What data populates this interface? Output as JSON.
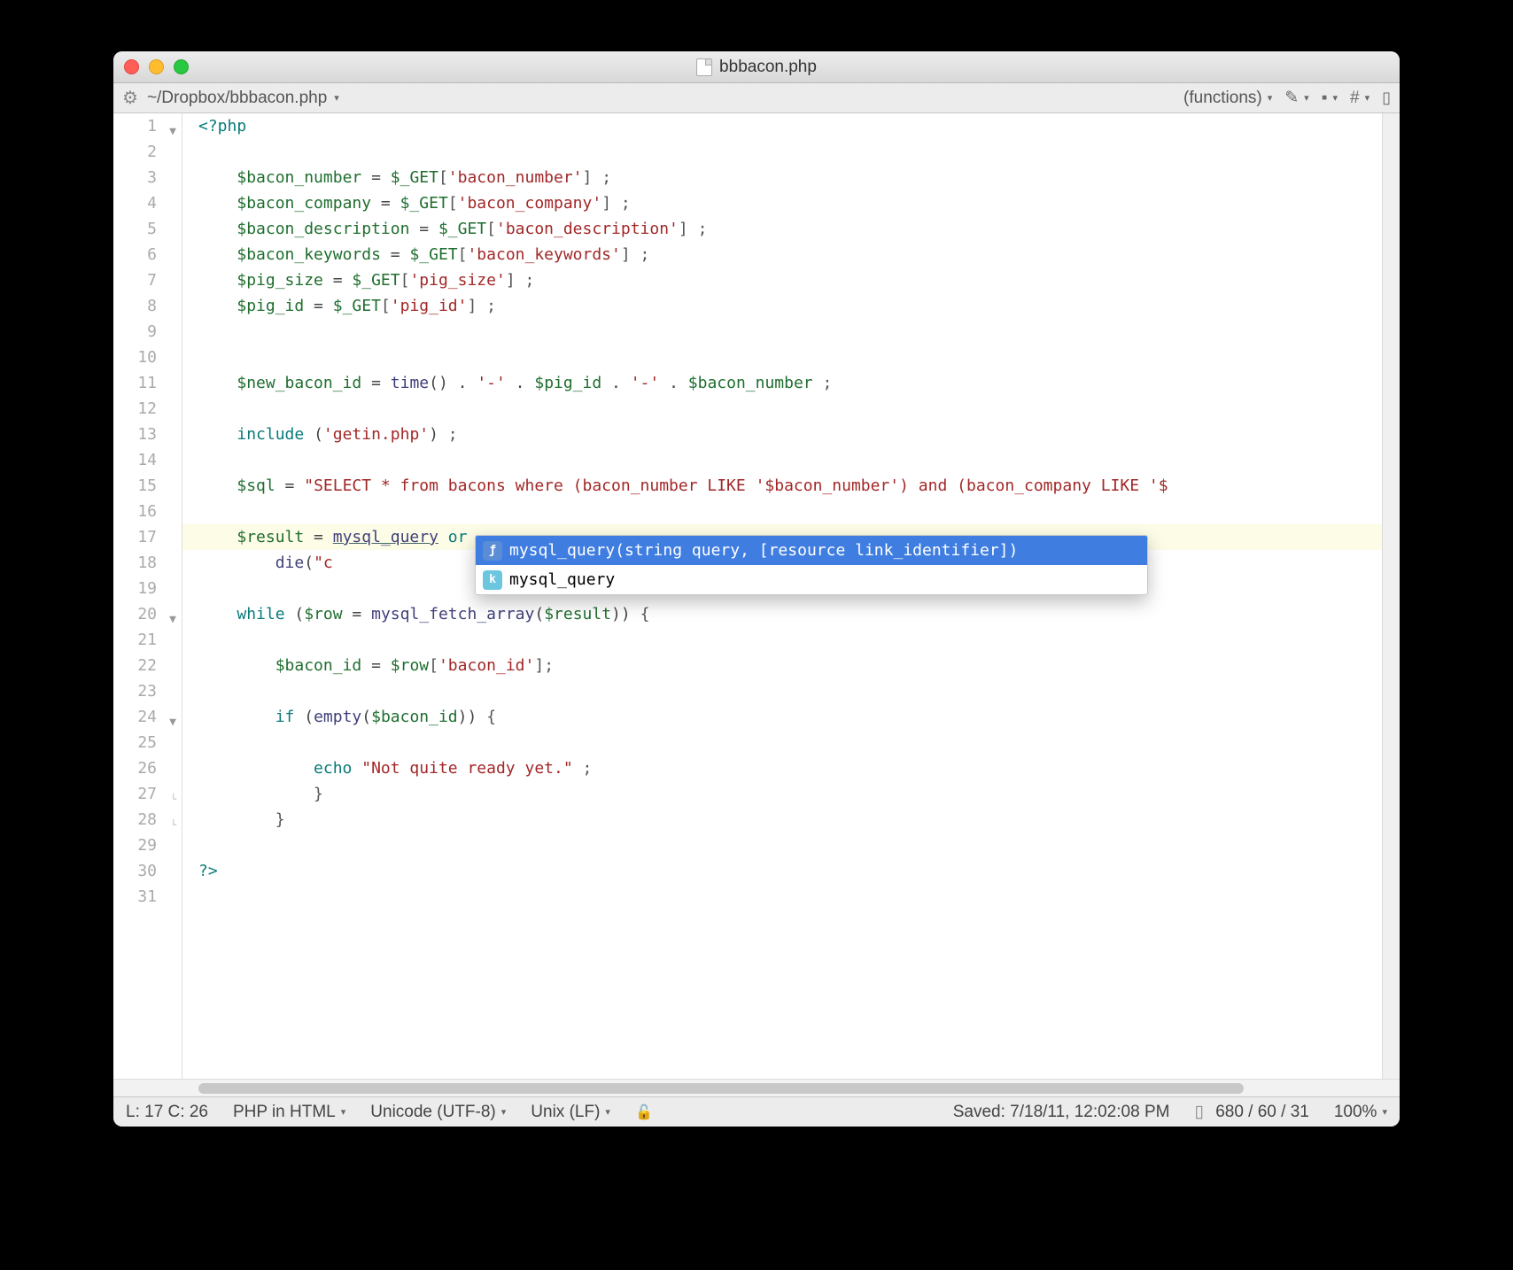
{
  "window": {
    "title": "bbbacon.php"
  },
  "toolbar": {
    "path": "~/Dropbox/bbbacon.php",
    "functions_label": "(functions)"
  },
  "gutter": {
    "lines": [
      "1",
      "2",
      "3",
      "4",
      "5",
      "6",
      "7",
      "8",
      "9",
      "10",
      "11",
      "12",
      "13",
      "14",
      "15",
      "16",
      "17",
      "18",
      "19",
      "20",
      "21",
      "22",
      "23",
      "24",
      "25",
      "26",
      "27",
      "28",
      "29",
      "30",
      "31"
    ],
    "fold_open": [
      1,
      20,
      24
    ],
    "fold_close": [
      27,
      28
    ]
  },
  "code": {
    "lines": {
      "l1_open": "<?php",
      "l3": {
        "var": "$bacon_number",
        "eq": " = ",
        "glob": "$_GET",
        "br1": "[",
        "str": "'bacon_number'",
        "br2": "]",
        "end": " ;"
      },
      "l4": {
        "var": "$bacon_company",
        "eq": " = ",
        "glob": "$_GET",
        "br1": "[",
        "str": "'bacon_company'",
        "br2": "]",
        "end": " ;"
      },
      "l5": {
        "var": "$bacon_description",
        "eq": " = ",
        "glob": "$_GET",
        "br1": "[",
        "str": "'bacon_description'",
        "br2": "]",
        "end": " ;"
      },
      "l6": {
        "var": "$bacon_keywords",
        "eq": " = ",
        "glob": "$_GET",
        "br1": "[",
        "str": "'bacon_keywords'",
        "br2": "]",
        "end": " ;"
      },
      "l7": {
        "var": "$pig_size",
        "eq": " = ",
        "glob": "$_GET",
        "br1": "[",
        "str": "'pig_size'",
        "br2": "]",
        "end": " ;"
      },
      "l8": {
        "var": "$pig_id",
        "eq": " = ",
        "glob": "$_GET",
        "br1": "[",
        "str": "'pig_id'",
        "br2": "]",
        "end": " ;"
      },
      "l11": {
        "var": "$new_bacon_id",
        "eq": " = ",
        "fn": "time",
        "p": "()",
        "cat": " . ",
        "s1": "'-'",
        "cat2": " . ",
        "var2": "$pig_id",
        "cat3": " . ",
        "s2": "'-'",
        "cat4": " . ",
        "var3": "$bacon_number",
        "end": " ;"
      },
      "l13": {
        "kw": "include",
        "sp": " ",
        "p1": "(",
        "str": "'getin.php'",
        "p2": ")",
        "end": " ;"
      },
      "l15": {
        "var": "$sql",
        "eq": " = ",
        "str": "\"SELECT * from bacons where (bacon_number LIKE '$bacon_number') and (bacon_company LIKE '$"
      },
      "l17": {
        "var": "$result",
        "eq": " = ",
        "call": "mysql_query",
        "sp": " ",
        "kw": "or"
      },
      "l18": {
        "fn": "die",
        "p1": "(",
        "str": "\"c",
        "cont": ""
      },
      "l20": {
        "kw": "while",
        "sp": " ",
        "p1": "(",
        "var": "$row",
        "eq": " = ",
        "fn": "mysql_fetch_array",
        "p2": "(",
        "var2": "$result",
        "p3": "))",
        "sp2": " ",
        "brace": "{"
      },
      "l22": {
        "var": "$bacon_id",
        "eq": " = ",
        "var2": "$row",
        "br1": "[",
        "str": "'bacon_id'",
        "br2": "]",
        "end": ";"
      },
      "l24": {
        "kw": "if",
        "sp": " ",
        "p1": "(",
        "fn": "empty",
        "p2": "(",
        "var": "$bacon_id",
        "p3": "))",
        "sp2": " ",
        "brace": "{"
      },
      "l26": {
        "kw": "echo",
        "sp": " ",
        "str": "\"Not quite ready yet.\"",
        "end": " ;"
      },
      "l27_brace": "}",
      "l28_brace": "}",
      "l30_close": "?>"
    }
  },
  "autocomplete": {
    "items": [
      {
        "badge": "f",
        "label": "mysql_query(string query, [resource link_identifier])",
        "selected": true
      },
      {
        "badge": "k",
        "label": "mysql_query",
        "selected": false
      }
    ]
  },
  "status": {
    "pos": "L: 17 C: 26",
    "lang": "PHP in HTML",
    "encoding": "Unicode (UTF-8)",
    "lineend": "Unix (LF)",
    "saved": "Saved: 7/18/11, 12:02:08 PM",
    "stats": "680 / 60 / 31",
    "zoom": "100%"
  }
}
